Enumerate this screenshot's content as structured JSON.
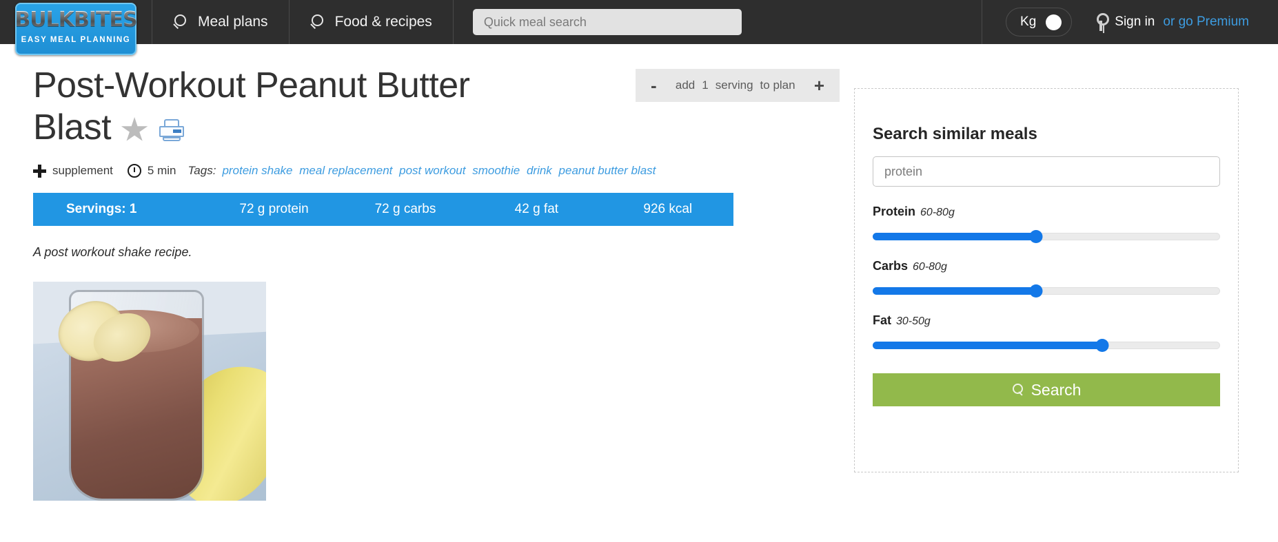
{
  "header": {
    "logo": {
      "main": "BULKBITES",
      "tagline": "EASY MEAL PLANNING"
    },
    "nav": [
      {
        "label": "Meal plans",
        "icon": "search-icon"
      },
      {
        "label": "Food & recipes",
        "icon": "search-icon"
      }
    ],
    "quick_search": {
      "placeholder": "Quick meal search",
      "value": ""
    },
    "unit_toggle": {
      "label": "Kg",
      "state": "on"
    },
    "auth": {
      "icon": "key-icon",
      "signin": "Sign in",
      "premium": "or go Premium"
    }
  },
  "recipe": {
    "title": "Post-Workout Peanut Butter Blast",
    "favorite_icon": "star-icon",
    "print_icon": "printer-icon",
    "plan_widget": {
      "decrement": "-",
      "add_label": "add",
      "quantity": "1",
      "unit": "serving",
      "to_plan": "to plan",
      "increment": "+"
    },
    "meta": {
      "type_icon": "plus-icon",
      "type": "supplement",
      "time_icon": "clock-icon",
      "time": "5 min",
      "tags_label": "Tags:",
      "tags": [
        "protein shake",
        "meal replacement",
        "post workout",
        "smoothie",
        "drink",
        "peanut butter blast"
      ]
    },
    "nutrition": {
      "servings": "Servings: 1",
      "protein": "72 g protein",
      "carbs": "72 g carbs",
      "fat": "42 g fat",
      "kcal": "926 kcal"
    },
    "description": "A post workout shake recipe.",
    "photo_alt": "chocolate peanut butter banana smoothie in a tall glass"
  },
  "sidebar": {
    "title": "Search similar meals",
    "keyword": {
      "value": "protein",
      "placeholder": "protein"
    },
    "sliders": [
      {
        "label": "Protein",
        "range": "60-80g",
        "percent": 47
      },
      {
        "label": "Carbs",
        "range": "60-80g",
        "percent": 47
      },
      {
        "label": "Fat",
        "range": "30-50g",
        "percent": 66
      }
    ],
    "search_button": {
      "label": "Search",
      "icon": "search-icon"
    }
  },
  "colors": {
    "header_bg": "#2e2e2e",
    "accent_blue": "#2196e3",
    "link_blue": "#3d9ce0",
    "slider_blue": "#1378e8",
    "search_green": "#92b94b"
  }
}
